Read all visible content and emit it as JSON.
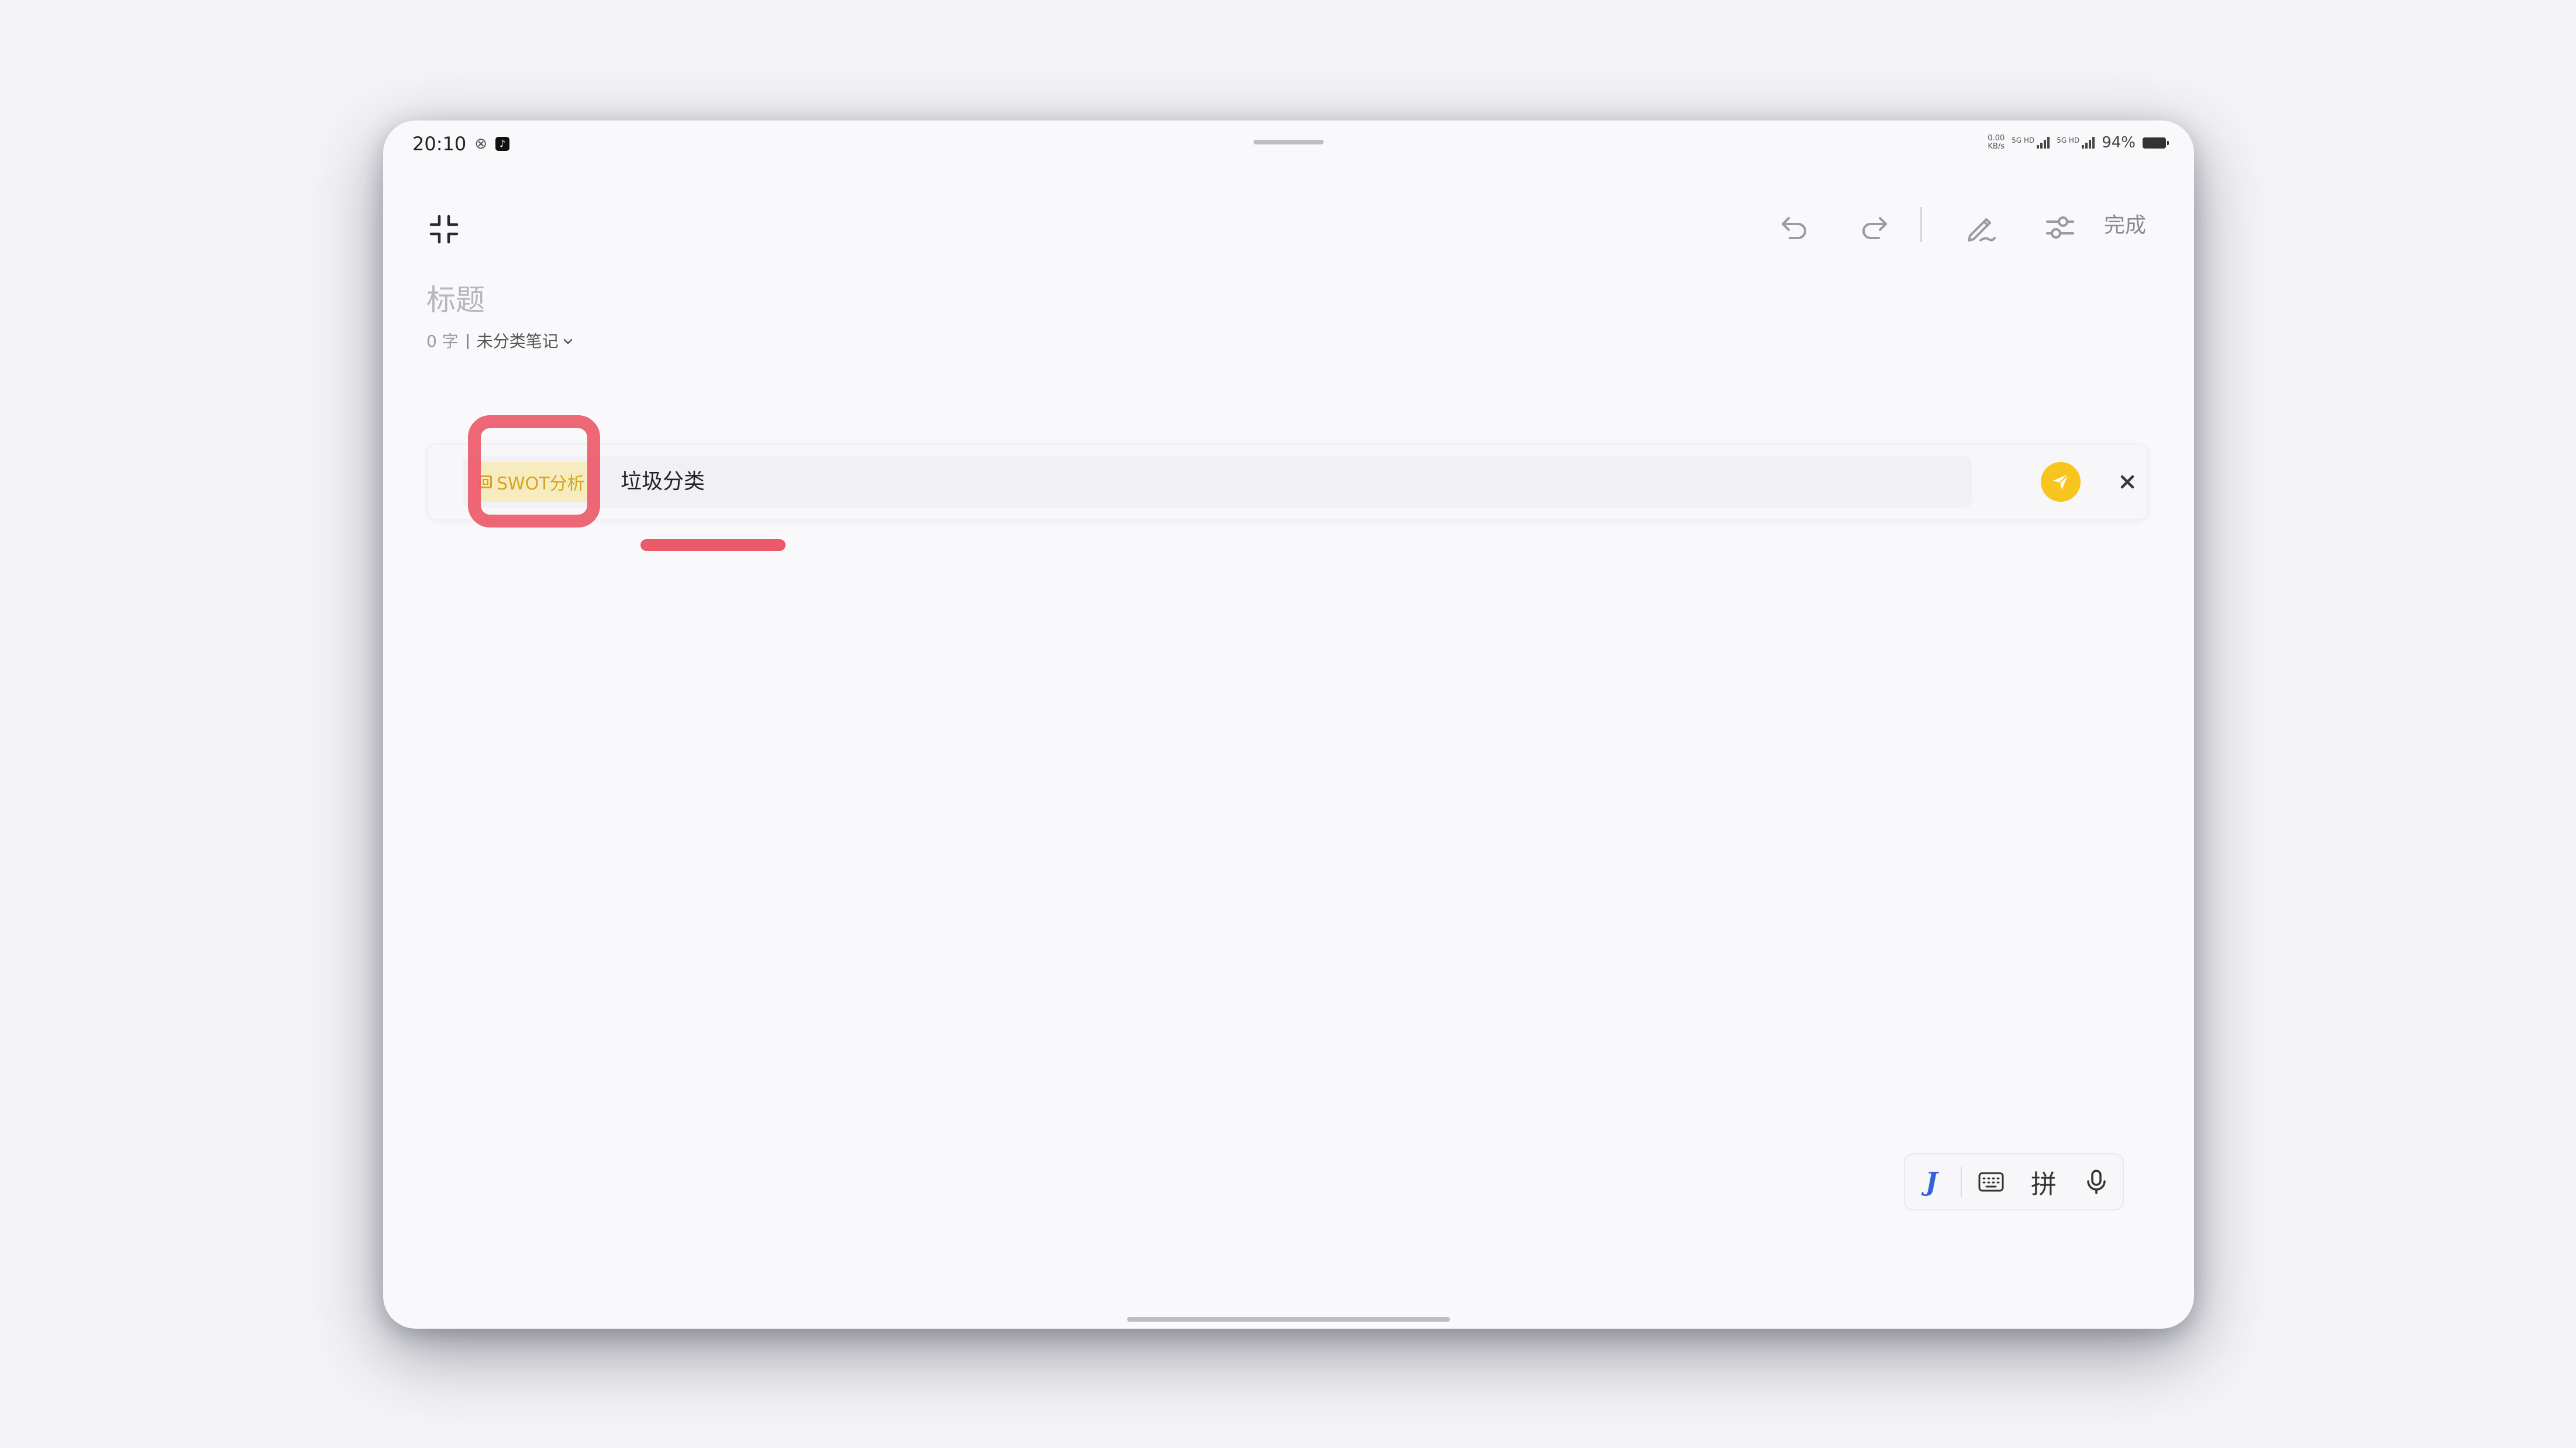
{
  "status_bar": {
    "time": "20:10",
    "misc_icon": "⊗",
    "net_speed_value": "0.00",
    "net_speed_unit": "KB/s",
    "signal_1_label": "5G HD",
    "signal_2_label": "5G HD",
    "battery_percent": "94%"
  },
  "toolbar": {
    "collapse_icon": "collapse-icon",
    "undo_icon": "undo-icon",
    "redo_icon": "redo-icon",
    "pen_icon": "pen-icon",
    "settings_icon": "settings-icon",
    "done_label": "完成"
  },
  "note": {
    "title_placeholder": "标题",
    "word_count": "0 字",
    "category": "未分类笔记",
    "category_icon": "chevron-down-icon"
  },
  "ai_bar": {
    "template_chip": "SWOT分析",
    "prompt_text": "垃圾分类",
    "send_icon": "send-icon",
    "close_icon": "close-icon"
  },
  "ime_bar": {
    "logo_label": "J",
    "keyboard_icon": "keyboard-icon",
    "pinyin_label": "拼",
    "mic_icon": "mic-icon"
  },
  "colors": {
    "accent": "#f7c51e",
    "highlight": "#ec5a6a",
    "ime_logo": "#3562d8"
  }
}
